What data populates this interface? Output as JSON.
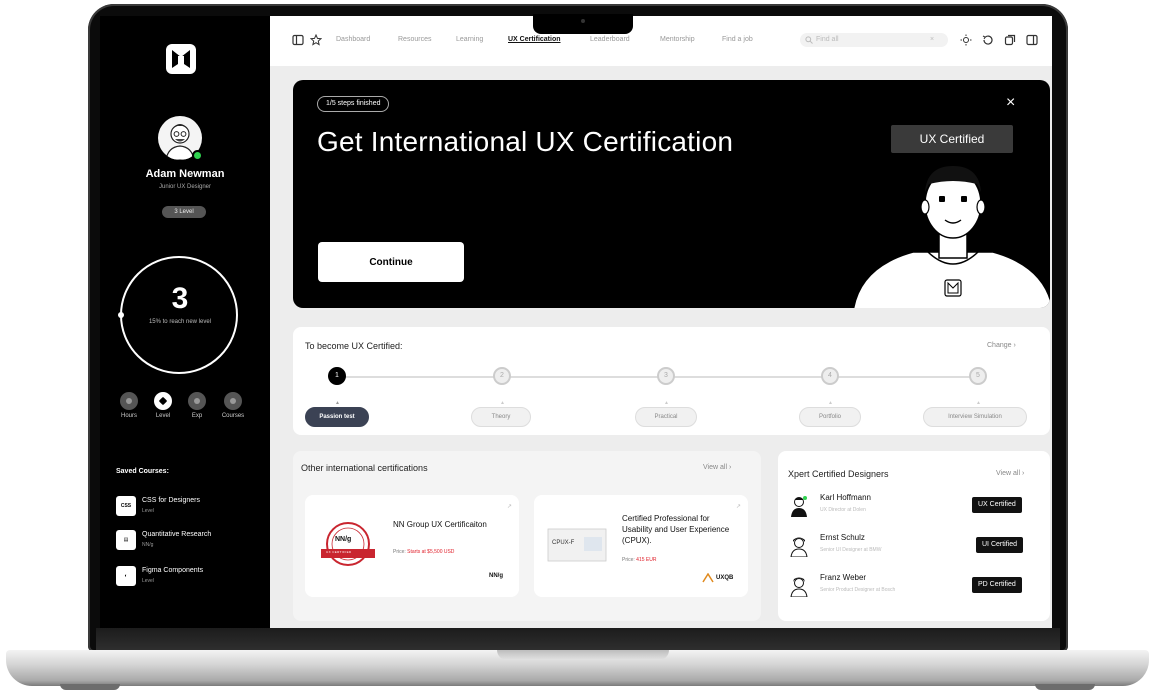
{
  "nav": {
    "links": [
      "Dashboard",
      "Resources",
      "Learning",
      "UX Certification",
      "Leaderboard",
      "Mentorship",
      "Find a job"
    ],
    "search_placeholder": "Find all"
  },
  "user": {
    "name": "Adam Newman",
    "role": "Junior UX Designer",
    "level_chip": "3 Level",
    "level_number": "3",
    "level_caption": "15% to reach new level",
    "progress_fraction": 0.15
  },
  "stats": [
    "Hours",
    "Level",
    "Exp",
    "Courses"
  ],
  "saved_courses": {
    "title": "Saved Courses:",
    "items": [
      {
        "icon": "CSS",
        "title": "CSS for Designers",
        "subtitle": "Level"
      },
      {
        "icon": "doc",
        "title": "Quantitative Research",
        "subtitle": "NN/g"
      },
      {
        "icon": "figma",
        "title": "Figma Components",
        "subtitle": "Level"
      }
    ]
  },
  "hero": {
    "steps_chip": "1/5 steps finished",
    "title": "Get International UX Certification",
    "continue_label": "Continue",
    "badge": "UX Certified",
    "close_icon": "×"
  },
  "path": {
    "title": "To become UX Certified:",
    "change_label": "Change",
    "steps": [
      {
        "num": "1",
        "label": "Passion test"
      },
      {
        "num": "2",
        "label": "Theory"
      },
      {
        "num": "3",
        "label": "Practical"
      },
      {
        "num": "4",
        "label": "Portfolio"
      },
      {
        "num": "5",
        "label": "Interview Simulation"
      }
    ]
  },
  "certifications": {
    "title": "Other international certifications",
    "view_all": "View all",
    "items": [
      {
        "name": "NN Group UX Certificaiton",
        "price_label": "Price:",
        "price": "Starts at $5,500 USD",
        "brand": "NN/g",
        "logo_text": "NN/g",
        "ribbon": "UX CERTIFIED"
      },
      {
        "name": "Certified Professional for Usability and User Experience (CPUX).",
        "price_label": "Price:",
        "price": "415 EUR",
        "brand": "UXQB",
        "logo_text": "CPUX-F"
      }
    ]
  },
  "designers": {
    "title": "Xpert Certified Designers",
    "view_all": "View all",
    "items": [
      {
        "name": "Karl Hoffmann",
        "role": "UX Director at Dolen",
        "tag": "UX Certified"
      },
      {
        "name": "Ernst Schulz",
        "role": "Senior UI Designer at BMW",
        "tag": "UI Certified"
      },
      {
        "name": "Franz Weber",
        "role": "Senior Product Designer at Bosch",
        "tag": "PD Certified"
      }
    ]
  },
  "colors": {
    "sidebar_bg": "#000000",
    "hero_bg": "#000000",
    "online": "#2fd24f",
    "active_step": "#3b4254",
    "price_red": "#e0202b"
  }
}
